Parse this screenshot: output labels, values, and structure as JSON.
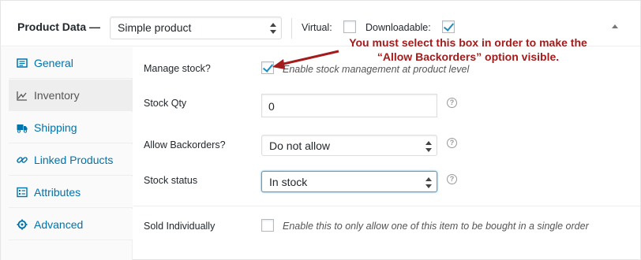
{
  "header": {
    "title": "Product Data —",
    "product_type": "Simple product",
    "virtual_label": "Virtual:",
    "virtual_checked": false,
    "downloadable_label": "Downloadable:",
    "downloadable_checked": true
  },
  "sidebar": {
    "items": [
      {
        "label": "General",
        "icon": "general-icon",
        "active": false
      },
      {
        "label": "Inventory",
        "icon": "inventory-icon",
        "active": true
      },
      {
        "label": "Shipping",
        "icon": "truck-icon",
        "active": false
      },
      {
        "label": "Linked Products",
        "icon": "link-icon",
        "active": false
      },
      {
        "label": "Attributes",
        "icon": "list-icon",
        "active": false
      },
      {
        "label": "Advanced",
        "icon": "gear-icon",
        "active": false
      }
    ]
  },
  "inventory": {
    "manage_stock_label": "Manage stock?",
    "manage_stock_checked": true,
    "manage_stock_desc": "Enable stock management at product level",
    "stock_qty_label": "Stock Qty",
    "stock_qty_value": "0",
    "backorders_label": "Allow Backorders?",
    "backorders_value": "Do not allow",
    "stock_status_label": "Stock status",
    "stock_status_value": "In stock",
    "sold_individually_label": "Sold Individually",
    "sold_individually_checked": false,
    "sold_individually_desc": "Enable this to only allow one of this item to be bought in a single order"
  },
  "annotation": {
    "line1": "You must select this box in order to make the",
    "line2": "“Allow Backorders” option visible.",
    "color": "#a41b1b"
  }
}
